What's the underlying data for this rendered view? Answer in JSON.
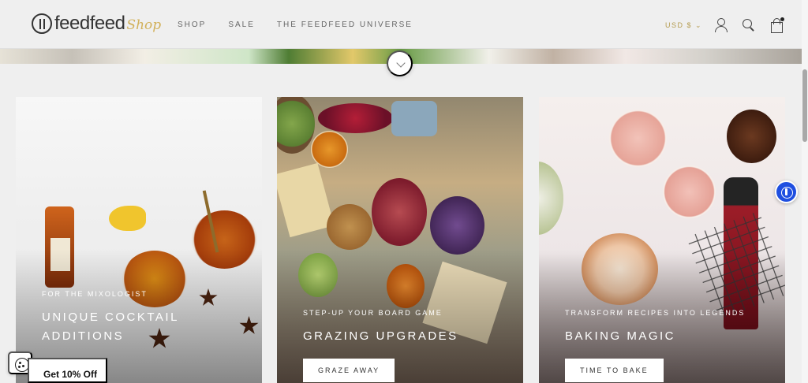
{
  "header": {
    "logo_text": "feedfeed",
    "logo_shop": "Shop",
    "nav": [
      "SHOP",
      "SALE",
      "THE FEEDFEED UNIVERSE"
    ],
    "currency": "USD $"
  },
  "cards": [
    {
      "eyebrow": "FOR THE MIXOLOGIST",
      "title_line1": "UNIQUE COCKTAIL",
      "title_line2": "ADDITIONS",
      "button": ""
    },
    {
      "eyebrow": "STEP-UP YOUR BOARD GAME",
      "title_line1": "GRAZING UPGRADES",
      "title_line2": "",
      "button": "GRAZE AWAY"
    },
    {
      "eyebrow": "TRANSFORM RECIPES INTO LEGENDS",
      "title_line1": "BAKING MAGIC",
      "title_line2": "",
      "button": "TIME TO BAKE"
    }
  ],
  "promo": {
    "label": "Get 10% Off"
  },
  "colors": {
    "background": "#efefef",
    "accent_gold": "#b49b4f",
    "accessibility_blue": "#1f4fe0"
  },
  "icons": [
    "user-icon",
    "search-icon",
    "bag-icon",
    "chevron-down-icon",
    "accessibility-icon",
    "cookie-icon"
  ]
}
